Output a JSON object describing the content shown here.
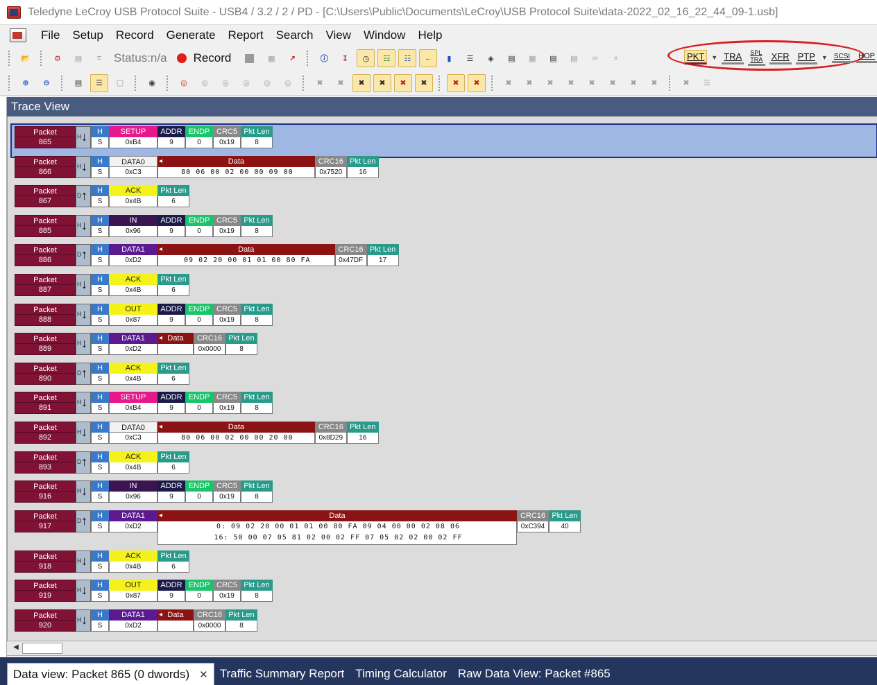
{
  "window": {
    "title": "Teledyne LeCroy USB Protocol Suite - USB4 / 3.2 / 2 / PD - [C:\\Users\\Public\\Documents\\LeCroy\\USB Protocol Suite\\data-2022_02_16_22_44_09-1.usb]"
  },
  "menu": [
    "File",
    "Setup",
    "Record",
    "Generate",
    "Report",
    "Search",
    "View",
    "Window",
    "Help"
  ],
  "toolbar": {
    "status_label": "Status:n/a",
    "record_label": "Record",
    "layer_buttons": [
      "PKT",
      "TRA",
      "SPL TRA",
      "XFR",
      "PTP",
      "SCSI",
      "HOP"
    ],
    "layer_active": "PKT",
    "colors": {
      "highlight": "#fbe7a8",
      "annotation": "#d82020"
    }
  },
  "trace_view": {
    "title": "Trace View",
    "packet_label": "Packet",
    "hs_header": "H",
    "hs_value": "S",
    "labels": {
      "addr": "ADDR",
      "endp": "ENDP",
      "crc5": "CRC5",
      "crc16": "CRC16",
      "pkt_len": "Pkt Len",
      "data": "Data"
    },
    "packets": [
      {
        "num": "865",
        "dir": "down",
        "pid": "SETUP",
        "pid_val": "0xB4",
        "type": "token",
        "addr": "9",
        "endp": "0",
        "crc5": "0x19",
        "len": "8",
        "selected": true
      },
      {
        "num": "866",
        "dir": "down",
        "pid": "DATA0",
        "pid_val": "0xC3",
        "type": "data",
        "data": "80 06 00 02 00 00 09 00",
        "crc16": "0x7520",
        "len": "16"
      },
      {
        "num": "867",
        "dir": "up",
        "pid": "ACK",
        "pid_val": "0x4B",
        "type": "hs",
        "len": "6"
      },
      {
        "num": "885",
        "dir": "down",
        "pid": "IN",
        "pid_val": "0x96",
        "type": "token",
        "addr": "9",
        "endp": "0",
        "crc5": "0x19",
        "len": "8"
      },
      {
        "num": "886",
        "dir": "up",
        "pid": "DATA1",
        "pid_val": "0xD2",
        "type": "data",
        "data": "09 02 20 00 01 01 00 80 FA",
        "crc16": "0x47DF",
        "len": "17"
      },
      {
        "num": "887",
        "dir": "down",
        "pid": "ACK",
        "pid_val": "0x4B",
        "type": "hs",
        "len": "6"
      },
      {
        "num": "888",
        "dir": "down",
        "pid": "OUT",
        "pid_val": "0x87",
        "type": "token",
        "addr": "9",
        "endp": "0",
        "crc5": "0x19",
        "len": "8"
      },
      {
        "num": "889",
        "dir": "down",
        "pid": "DATA1",
        "pid_val": "0xD2",
        "type": "data",
        "data": "",
        "crc16": "0x0000",
        "len": "8"
      },
      {
        "num": "890",
        "dir": "up",
        "pid": "ACK",
        "pid_val": "0x4B",
        "type": "hs",
        "len": "6"
      },
      {
        "num": "891",
        "dir": "down",
        "pid": "SETUP",
        "pid_val": "0xB4",
        "type": "token",
        "addr": "9",
        "endp": "0",
        "crc5": "0x19",
        "len": "8"
      },
      {
        "num": "892",
        "dir": "down",
        "pid": "DATA0",
        "pid_val": "0xC3",
        "type": "data",
        "data": "80 06 00 02 00 00 20 00",
        "crc16": "0x8D29",
        "len": "16"
      },
      {
        "num": "893",
        "dir": "up",
        "pid": "ACK",
        "pid_val": "0x4B",
        "type": "hs",
        "len": "6"
      },
      {
        "num": "916",
        "dir": "down",
        "pid": "IN",
        "pid_val": "0x96",
        "type": "token",
        "addr": "9",
        "endp": "0",
        "crc5": "0x19",
        "len": "8"
      },
      {
        "num": "917",
        "dir": "up",
        "pid": "DATA1",
        "pid_val": "0xD2",
        "type": "data",
        "data": " 0: 09 02 20 00 01 01 00 80 FA 09 04 00 00 02 08 06",
        "data2": "16: 50 00 07 05 81 02 00 02 FF 07 05 02 02 00 02 FF",
        "crc16": "0xC394",
        "len": "40"
      },
      {
        "num": "918",
        "dir": "down",
        "pid": "ACK",
        "pid_val": "0x4B",
        "type": "hs",
        "len": "6"
      },
      {
        "num": "919",
        "dir": "down",
        "pid": "OUT",
        "pid_val": "0x87",
        "type": "token",
        "addr": "9",
        "endp": "0",
        "crc5": "0x19",
        "len": "8"
      },
      {
        "num": "920",
        "dir": "down",
        "pid": "DATA1",
        "pid_val": "0xD2",
        "type": "data",
        "data": "",
        "crc16": "0x0000",
        "len": "8"
      }
    ]
  },
  "tabs": [
    {
      "label": "Data view: Packet 865 (0 dwords)",
      "active": true,
      "closable": true
    },
    {
      "label": "Traffic Summary Report"
    },
    {
      "label": "Timing Calculator"
    },
    {
      "label": "Raw Data View: Packet #865"
    }
  ]
}
